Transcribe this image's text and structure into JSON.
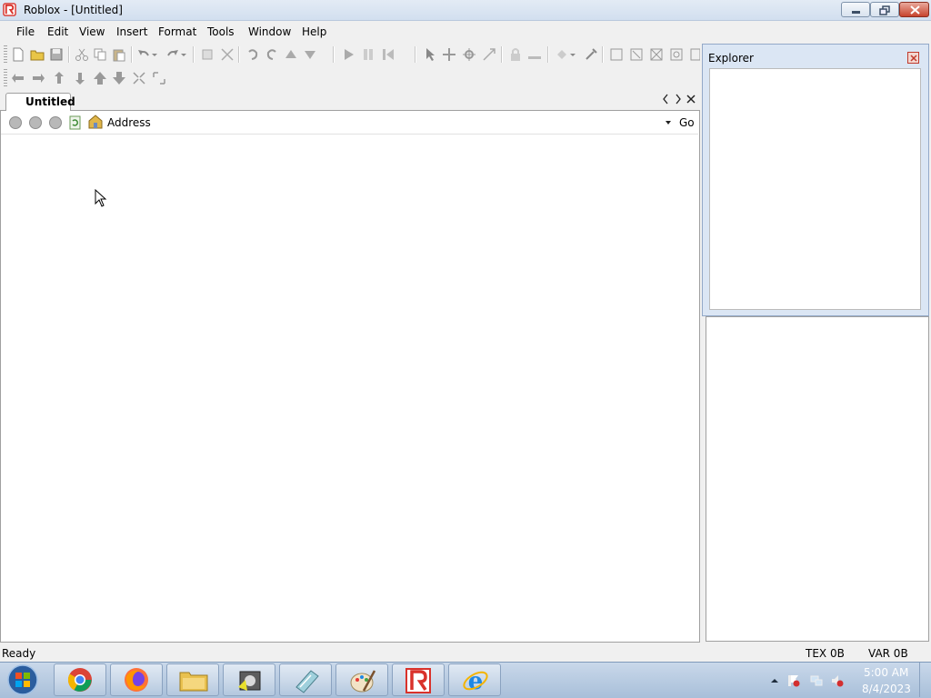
{
  "window": {
    "title": "Roblox - [Untitled]"
  },
  "menu": [
    "File",
    "Edit",
    "View",
    "Insert",
    "Format",
    "Tools",
    "Window",
    "Help"
  ],
  "document": {
    "tab_label": "Untitled",
    "address_label": "Address",
    "go_label": "Go"
  },
  "explorer": {
    "title": "Explorer"
  },
  "status": {
    "left": "Ready",
    "tex": "TEX 0B",
    "var": "VAR 0B"
  },
  "taskbar": {
    "apps": [
      "chrome-icon",
      "firefox-icon",
      "file-explorer-icon",
      "media-player-icon",
      "notepad-icon",
      "paint-icon",
      "roblox-icon",
      "internet-explorer-icon"
    ],
    "time": "5:00 AM",
    "date": "8/4/2023"
  },
  "colors": {
    "accent": "#3a6ea5",
    "roblox_red": "#d9322b",
    "taskbar": "#b8cce4"
  }
}
